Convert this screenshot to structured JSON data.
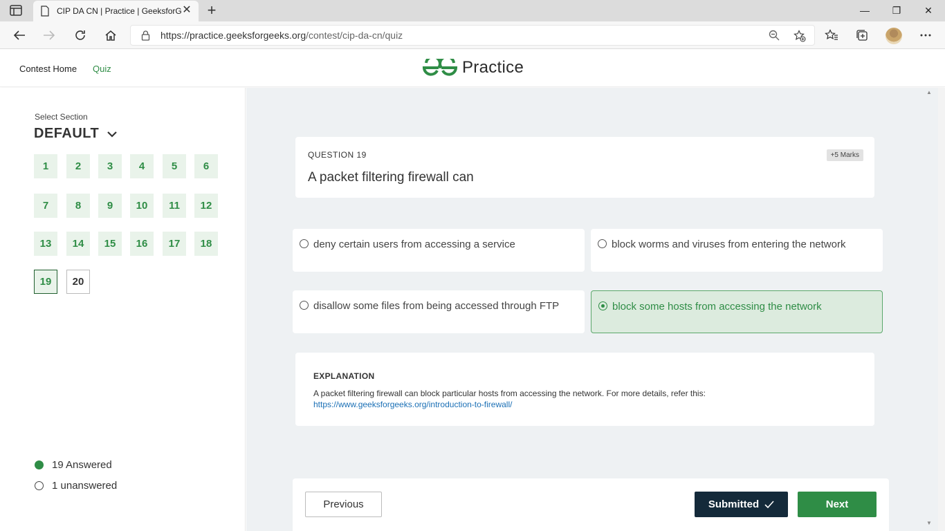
{
  "browser": {
    "tab_title": "CIP DA CN | Practice | GeeksforG",
    "url_host": "https://practice.geeksforgeeks.org",
    "url_path": "/contest/cip-da-cn/quiz",
    "icons": [
      "tab-actions-icon",
      "page-icon",
      "close-icon",
      "plus-icon",
      "back-icon",
      "forward-icon",
      "reload-icon",
      "home-icon",
      "lock-icon",
      "zoom-icon",
      "add-favorite-icon",
      "favorites-icon",
      "collections-icon",
      "more-icon"
    ]
  },
  "header": {
    "contest_home": "Contest Home",
    "quiz": "Quiz",
    "logo_text": "Practice",
    "brand_color": "#2f8d46"
  },
  "sidebar": {
    "select_label": "Select Section",
    "section_name": "DEFAULT",
    "questions": [
      "1",
      "2",
      "3",
      "4",
      "5",
      "6",
      "7",
      "8",
      "9",
      "10",
      "11",
      "12",
      "13",
      "14",
      "15",
      "16",
      "17",
      "18",
      "19",
      "20"
    ],
    "current": "19",
    "answered_label": "19 Answered",
    "unanswered_label": "1 unanswered"
  },
  "question": {
    "number_label": "QUESTION 19",
    "marks": "+5 Marks",
    "text": "A packet filtering firewall can",
    "options": [
      {
        "label": "deny certain users from accessing a service",
        "selected": false
      },
      {
        "label": "block worms and viruses from entering the network",
        "selected": false
      },
      {
        "label": "disallow some files from being accessed through FTP",
        "selected": false
      },
      {
        "label": "block some hosts from accessing the network",
        "selected": true
      }
    ]
  },
  "explanation": {
    "title": "EXPLANATION",
    "text": "A packet filtering firewall can block particular hosts from accessing the network. For more details, refer this:",
    "link": "https://www.geeksforgeeks.org/introduction-to-firewall/"
  },
  "footer": {
    "previous": "Previous",
    "submitted": "Submitted",
    "next": "Next"
  }
}
